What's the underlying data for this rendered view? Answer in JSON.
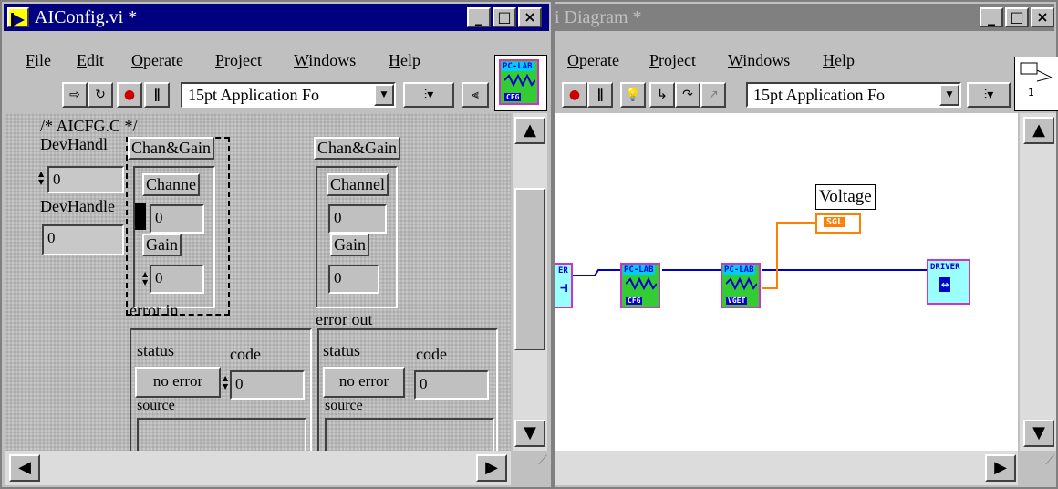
{
  "front_panel": {
    "title": "AIConfig.vi *",
    "menu": [
      "File",
      "Edit",
      "Operate",
      "Project",
      "Windows",
      "Help"
    ],
    "font_selector": "15pt Application Fo",
    "icon_top": "PC-LAB",
    "icon_bottom": "CFG",
    "comment": "/* AICFG.C */",
    "dev_handle_in_label": "DevHandl",
    "dev_handle_in_value": "0",
    "dev_handle_out_label": "DevHandle",
    "dev_handle_out_value": "0",
    "chan_gain_in": {
      "label": "Chan&Gain",
      "channel_label": "Channe",
      "channel_value": "0",
      "gain_label": "Gain",
      "gain_value": "0"
    },
    "chan_gain_out": {
      "label": "Chan&Gain",
      "channel_label": "Channel",
      "channel_value": "0",
      "gain_label": "Gain",
      "gain_value": "0"
    },
    "error_in": {
      "label": "error in",
      "status_label": "status",
      "code_label": "code",
      "status_value": "no error",
      "code_value": "0",
      "source_label": "source"
    },
    "error_out": {
      "label": "error out",
      "status_label": "status",
      "code_label": "code",
      "status_value": "no error",
      "code_value": "0",
      "source_label": "source"
    }
  },
  "block_diagram": {
    "title": "i Diagram *",
    "menu": [
      "Operate",
      "Project",
      "Windows",
      "Help"
    ],
    "font_selector": "15pt Application Fo",
    "voltage_label": "Voltage",
    "sgl_label": "SGL",
    "block1": {
      "top": "PC-LAB",
      "bottom": "CFG"
    },
    "block2": {
      "top": "PC-LAB",
      "bottom": "VGET"
    },
    "driver_left": "ER",
    "driver_right": "DRIVER",
    "connector_number": "1"
  },
  "colors": {
    "title_active": "#000080",
    "title_inactive": "#808080",
    "wire": "#0000cc",
    "sgl_wire": "#ff8000",
    "vi_block": "#33cc33",
    "driver_block": "#99ffff"
  }
}
